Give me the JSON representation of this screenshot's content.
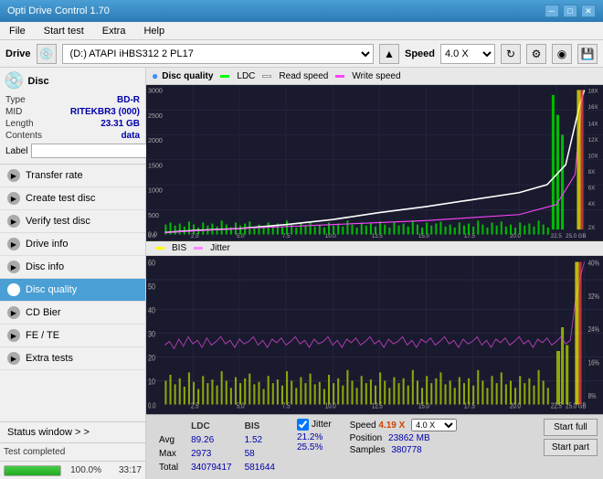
{
  "window": {
    "title": "Opti Drive Control 1.70",
    "min_btn": "─",
    "max_btn": "□",
    "close_btn": "✕"
  },
  "menu": {
    "items": [
      "File",
      "Start test",
      "Extra",
      "Help"
    ]
  },
  "drive_bar": {
    "label": "Drive",
    "drive_value": "(D:) ATAPI iHBS312  2 PL17",
    "speed_label": "Speed",
    "speed_value": "4.0 X"
  },
  "disc": {
    "title": "Disc",
    "rows": [
      {
        "key": "Type",
        "val": "BD-R"
      },
      {
        "key": "MID",
        "val": "RITEKBR3 (000)"
      },
      {
        "key": "Length",
        "val": "23.31 GB"
      },
      {
        "key": "Contents",
        "val": "data"
      }
    ],
    "label_key": "Label",
    "label_val": ""
  },
  "nav": {
    "items": [
      {
        "id": "transfer-rate",
        "label": "Transfer rate",
        "active": false
      },
      {
        "id": "create-test-disc",
        "label": "Create test disc",
        "active": false
      },
      {
        "id": "verify-test-disc",
        "label": "Verify test disc",
        "active": false
      },
      {
        "id": "drive-info",
        "label": "Drive info",
        "active": false
      },
      {
        "id": "disc-info",
        "label": "Disc info",
        "active": false
      },
      {
        "id": "disc-quality",
        "label": "Disc quality",
        "active": true
      },
      {
        "id": "cd-bier",
        "label": "CD Bier",
        "active": false
      },
      {
        "id": "fe-te",
        "label": "FE / TE",
        "active": false
      },
      {
        "id": "extra-tests",
        "label": "Extra tests",
        "active": false
      }
    ]
  },
  "status_window": {
    "label": "Status window > >"
  },
  "status_bar": {
    "text": "Test completed",
    "progress": 100,
    "progress_text": "100.0%",
    "time": "33:17"
  },
  "chart": {
    "title": "Disc quality",
    "top": {
      "legends": [
        {
          "label": "LDC",
          "color": "#00ff00"
        },
        {
          "label": "Read speed",
          "color": "#ffffff"
        },
        {
          "label": "Write speed",
          "color": "#ff44ff"
        }
      ],
      "y_max": 3000,
      "y_labels": [
        "3000",
        "2500",
        "2000",
        "1500",
        "1000",
        "500",
        "0.0"
      ],
      "y_right": [
        "18X",
        "16X",
        "14X",
        "12X",
        "10X",
        "8X",
        "6X",
        "4X",
        "2X"
      ],
      "x_labels": [
        "0.0",
        "2.5",
        "5.0",
        "7.5",
        "10.0",
        "12.5",
        "15.0",
        "17.5",
        "20.0",
        "22.5",
        "25.0 GB"
      ]
    },
    "bottom": {
      "legends": [
        {
          "label": "BIS",
          "color": "#ffff00"
        },
        {
          "label": "Jitter",
          "color": "#ff88ff"
        }
      ],
      "y_max": 60,
      "y_labels": [
        "60",
        "50",
        "40",
        "30",
        "20",
        "10"
      ],
      "y_right": [
        "40%",
        "32%",
        "24%",
        "16%",
        "8%"
      ],
      "x_labels": [
        "0.0",
        "2.5",
        "5.0",
        "7.5",
        "10.0",
        "12.5",
        "15.0",
        "17.5",
        "20.0",
        "22.5",
        "25.0 GB"
      ]
    }
  },
  "stats": {
    "columns": [
      "LDC",
      "BIS"
    ],
    "jitter_label": "Jitter",
    "speed_label": "Speed",
    "speed_val": "4.19 X",
    "speed_select": "4.0 X",
    "position_label": "Position",
    "position_val": "23862 MB",
    "samples_label": "Samples",
    "samples_val": "380778",
    "rows": [
      {
        "label": "Avg",
        "ldc": "89.26",
        "bis": "1.52",
        "jitter": "21.2%"
      },
      {
        "label": "Max",
        "ldc": "2973",
        "bis": "58",
        "jitter": "25.5%"
      },
      {
        "label": "Total",
        "ldc": "34079417",
        "bis": "581644",
        "jitter": ""
      }
    ],
    "btn_start_full": "Start full",
    "btn_start_part": "Start part"
  }
}
